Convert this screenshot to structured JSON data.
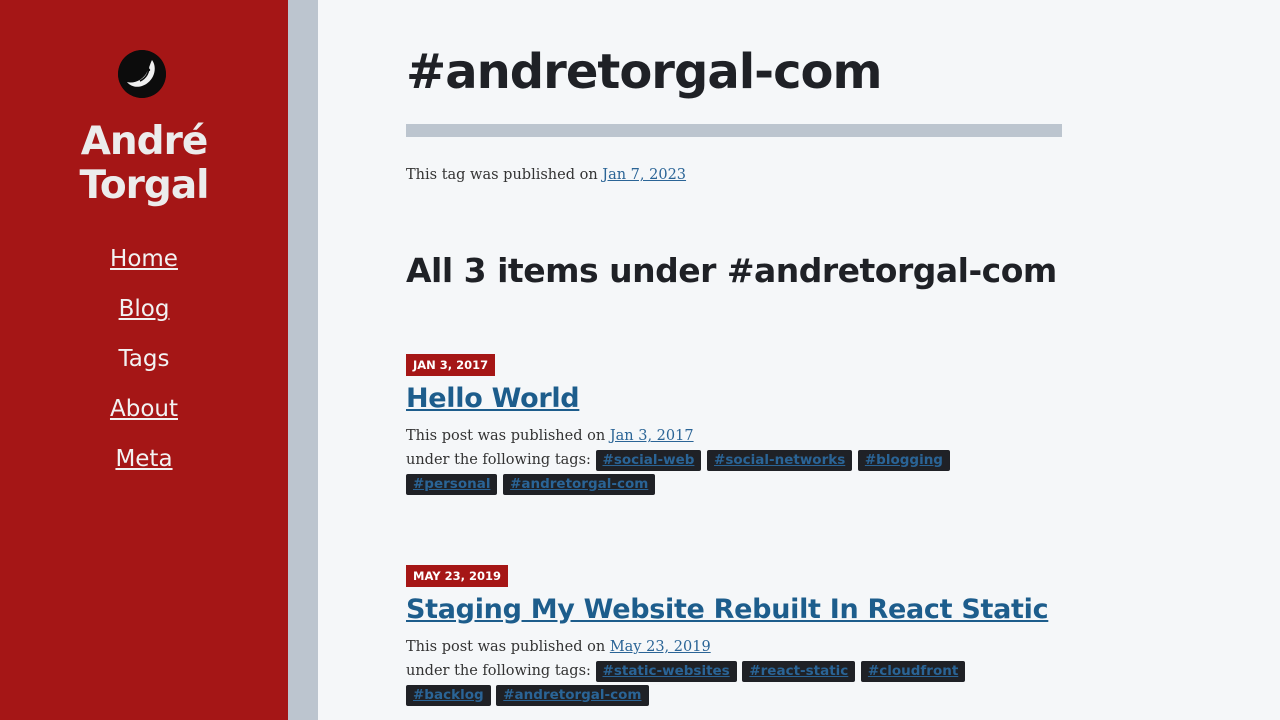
{
  "site": {
    "name_line1": "André",
    "name_line2": "Torgal",
    "logo_icon": "moon-face-logo-icon"
  },
  "nav": {
    "items": [
      {
        "label": "Home",
        "active": false
      },
      {
        "label": "Blog",
        "active": false
      },
      {
        "label": "Tags",
        "active": true
      },
      {
        "label": "About",
        "active": false
      },
      {
        "label": "Meta",
        "active": false
      }
    ]
  },
  "page": {
    "title": "#andretorgal-com",
    "published_prefix": "This tag was published on ",
    "published_date": "Jan 7, 2023",
    "section_title": "All 3 items under #andretorgal-com"
  },
  "posts": [
    {
      "badge": "JAN 3, 2017",
      "title": "Hello World",
      "published_prefix": "This post was published on ",
      "published_date": "Jan 3, 2017",
      "tags_prefix": "under the following tags: ",
      "tags": [
        "#social-web",
        "#social-networks",
        "#blogging",
        "#personal",
        "#andretorgal-com"
      ]
    },
    {
      "badge": "MAY 23, 2019",
      "title": "Staging My Website Rebuilt In React Static",
      "published_prefix": "This post was published on ",
      "published_date": "May 23, 2019",
      "tags_prefix": "under the following tags: ",
      "tags": [
        "#static-websites",
        "#react-static",
        "#cloudfront",
        "#backlog",
        "#andretorgal-com"
      ]
    }
  ],
  "colors": {
    "sidebar": "#a51616",
    "gutter": "#bcc5cf",
    "link": "#1d5d8c",
    "tag_bg": "#1f2126"
  }
}
